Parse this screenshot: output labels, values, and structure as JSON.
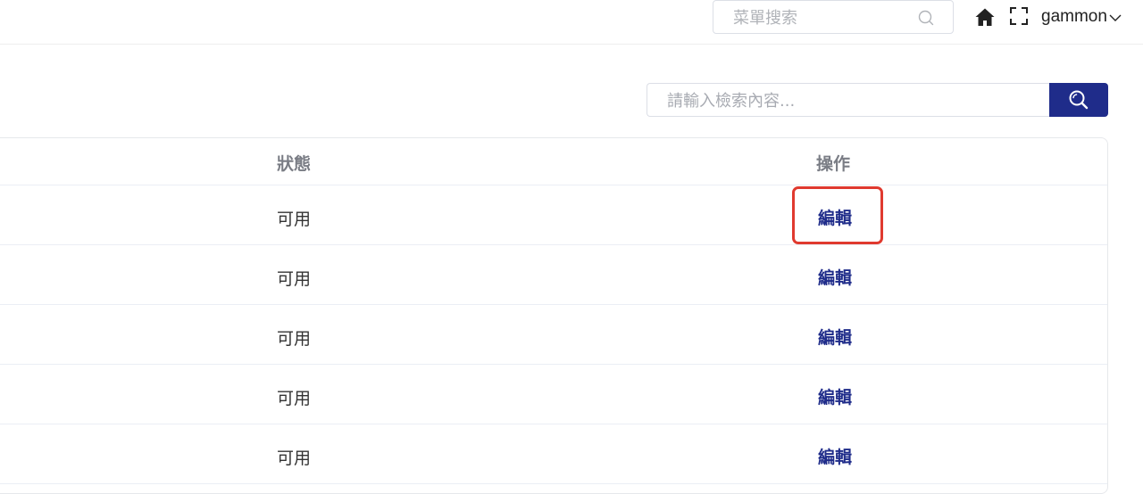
{
  "header": {
    "menu_search_placeholder": "菜單搜索",
    "username": "gammon"
  },
  "search": {
    "placeholder": "請輸入檢索內容..."
  },
  "table": {
    "columns": [
      "狀態",
      "操作"
    ],
    "rows": [
      {
        "status": "可用",
        "action": "編輯"
      },
      {
        "status": "可用",
        "action": "編輯"
      },
      {
        "status": "可用",
        "action": "編輯"
      },
      {
        "status": "可用",
        "action": "編輯"
      },
      {
        "status": "可用",
        "action": "編輯"
      }
    ]
  },
  "colors": {
    "accent": "#1f2c8a",
    "highlight": "#e03a2f"
  },
  "icons": {
    "menu_search": "search-icon",
    "home": "home-icon",
    "fullscreen": "fullscreen-icon",
    "user_dropdown": "chevron-down-icon",
    "search_button": "search-icon"
  }
}
